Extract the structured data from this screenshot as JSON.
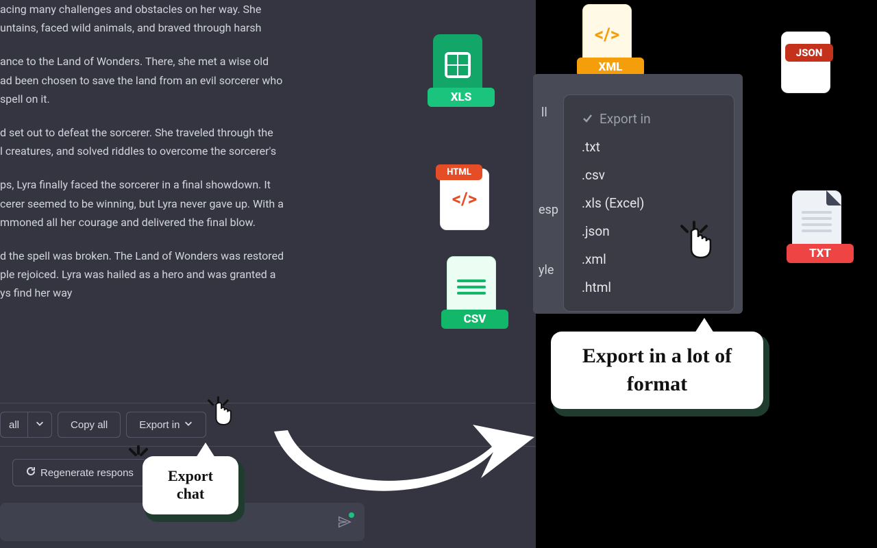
{
  "story": {
    "p1": "acing many challenges and obstacles on her way. She",
    "p2": "untains, faced wild animals, and braved through harsh",
    "p3": "ance to the Land of Wonders. There, she met a wise old",
    "p4": "ad been chosen to save the land from an evil sorcerer who",
    "p5": "spell on it.",
    "p6": "d set out to defeat the sorcerer. She traveled through the",
    "p7": "l creatures, and solved riddles to overcome the sorcerer's",
    "p8": "ps, Lyra finally faced the sorcerer in a final showdown. It",
    "p9": "cerer seemed to be winning, but Lyra never gave up. With a",
    "p10": "mmoned all her courage and delivered the final blow.",
    "p11": "d the spell was broken. The Land of Wonders was restored",
    "p12": "ple rejoiced. Lyra was hailed as a hero and was granted a",
    "p13": "ys find her way"
  },
  "toolbar": {
    "all": "all",
    "copy_all": "Copy all",
    "export_in": "Export in",
    "regenerate": "Regenerate respons"
  },
  "callouts": {
    "export_chat": "Export chat",
    "export_formats": "Export in a lot of format"
  },
  "exportDropdown": {
    "header": "Export in",
    "options": [
      ".txt",
      ".csv",
      ".xls (Excel)",
      ".json",
      ".xml",
      ".html"
    ]
  },
  "peek": {
    "ll": "ll",
    "esp": "esp",
    "yle": "yle"
  },
  "badges": {
    "xls": "XLS",
    "html": "HTML",
    "csv": "CSV",
    "xml": "XML",
    "json": "JSON",
    "txt": "TXT"
  }
}
